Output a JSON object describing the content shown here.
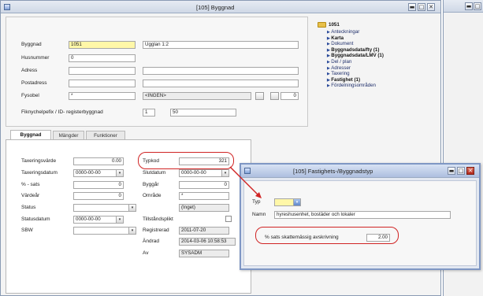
{
  "main_window": {
    "title": "[105] Byggnad"
  },
  "form": {
    "byggnad": {
      "label": "Byggnad",
      "code": "1051",
      "name": "Ugglan 1:2"
    },
    "husnummer": {
      "label": "Husnummer",
      "value": "0"
    },
    "adress": {
      "label": "Adress",
      "value": ""
    },
    "postadress": {
      "label": "Postadress",
      "value": ""
    },
    "fysobel": {
      "label": "Fysobel",
      "value": "*",
      "mid": "<INGEN>",
      "num": "0"
    },
    "fiknr": {
      "label": "Fiknychelpefix / ID- registerbyggnad",
      "a": "1",
      "b": "50"
    }
  },
  "tabs": [
    {
      "label": "Byggnad",
      "active": true
    },
    {
      "label": "Mängder",
      "active": false
    },
    {
      "label": "Funktioner",
      "active": false
    }
  ],
  "tab_content": {
    "left": [
      {
        "label": "Taxeringsvärde",
        "value": "0.00"
      },
      {
        "label": "Taxeringsdatum",
        "value": "0000-00-00"
      },
      {
        "label": "% - sats",
        "value": "0"
      },
      {
        "label": "Värdeår",
        "value": "0"
      },
      {
        "label": "Status",
        "value": ""
      },
      {
        "label": "Statusdatum",
        "value": "0000-00-00"
      },
      {
        "label": "SBW",
        "value": ""
      }
    ],
    "right": {
      "typkod": {
        "label": "Typkod",
        "value": "321"
      },
      "slutdatum": {
        "label": "Slutdatum",
        "value": "0000-00-00"
      },
      "byggar": {
        "label": "Byggår",
        "value": "0"
      },
      "omrade": {
        "label": "Område",
        "value": "*"
      },
      "omrade_text": {
        "value": "(Inget)"
      },
      "tillandsplikt": {
        "label": "Tillståndsplikt"
      },
      "registrerad": {
        "label": "Registrerad",
        "value": "2011-07-20"
      },
      "andrad": {
        "label": "Ändrad",
        "value": "2014-03-06 10:58:53"
      },
      "av": {
        "label": "Av",
        "value": "SYSADM"
      }
    }
  },
  "tree": {
    "root": "1051",
    "items": [
      {
        "label": "Anteckningar",
        "bold": false
      },
      {
        "label": "Karta",
        "bold": true
      },
      {
        "label": "Dokument",
        "bold": false
      },
      {
        "label": "Byggnadsdata/fty (1)",
        "bold": true
      },
      {
        "label": "Byggnadsdata/LMV (1)",
        "bold": true
      },
      {
        "label": "Del / plan",
        "bold": false
      },
      {
        "label": "Adresser",
        "bold": false
      },
      {
        "label": "Taxering",
        "bold": false
      },
      {
        "label": "Fastighet (1)",
        "bold": true
      },
      {
        "label": "Fördelningsområden",
        "bold": false
      }
    ]
  },
  "dialog": {
    "title": "[105]  Fastighets-/Byggnadstyp",
    "typ_label": "Typ",
    "typ_value": "",
    "namn_label": "Namn",
    "namn_value": "hyreshusenhet, bostäder och lokaler",
    "sats_label": "% sats skattemässig avskrivning",
    "sats_value": "2.00"
  },
  "window_buttons": {
    "minimize": "▬",
    "maximize": "□",
    "close": "✕"
  },
  "colors": {
    "highlight_field": "#fff7a8",
    "annotation_red": "#d02424",
    "title_bar": "#cfd8e6",
    "tree_link": "#1f2f6b"
  },
  "icons": [
    "app-icon",
    "folder-icon",
    "dropdown-arrow-icon",
    "tree-arrow-icon",
    "minimize-icon",
    "maximize-icon",
    "close-icon"
  ]
}
